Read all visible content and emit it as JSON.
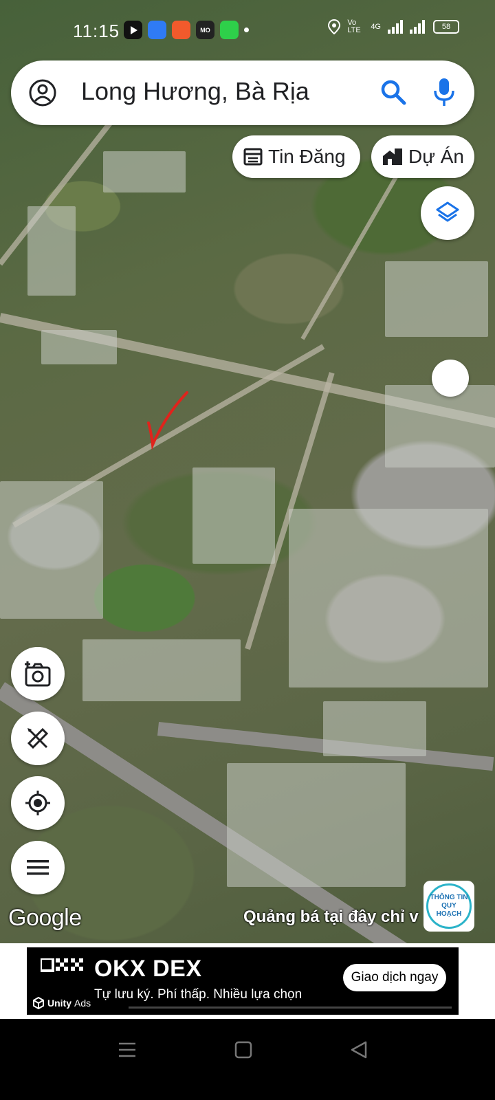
{
  "status_bar": {
    "time": "11:15",
    "network_label": "Vo LTE",
    "signal_label": "4G",
    "battery": "58"
  },
  "search": {
    "query": "Long Hương, Bà Rịa",
    "icons": [
      "account-icon",
      "search-icon",
      "microphone-icon"
    ]
  },
  "chips": {
    "tin_dang": "Tin Đăng",
    "du_an": "Dự Án"
  },
  "map_overlay": {
    "google_label": "Google",
    "promo_text": "Quảng bá tại đây chỉ v",
    "badge_text": "THÔNG TIN QUY HOẠCH"
  },
  "ad": {
    "brand": "OKX DEX",
    "subtitle": "Tự lưu ký. Phí thấp. Nhiều lựa chọn",
    "cta": "Giao dịch ngay",
    "network": "Unity",
    "network_suffix": "Ads"
  },
  "colors": {
    "accent_blue": "#1a73e8",
    "badge_teal": "#2bb3c9",
    "ad_background": "#000000"
  }
}
